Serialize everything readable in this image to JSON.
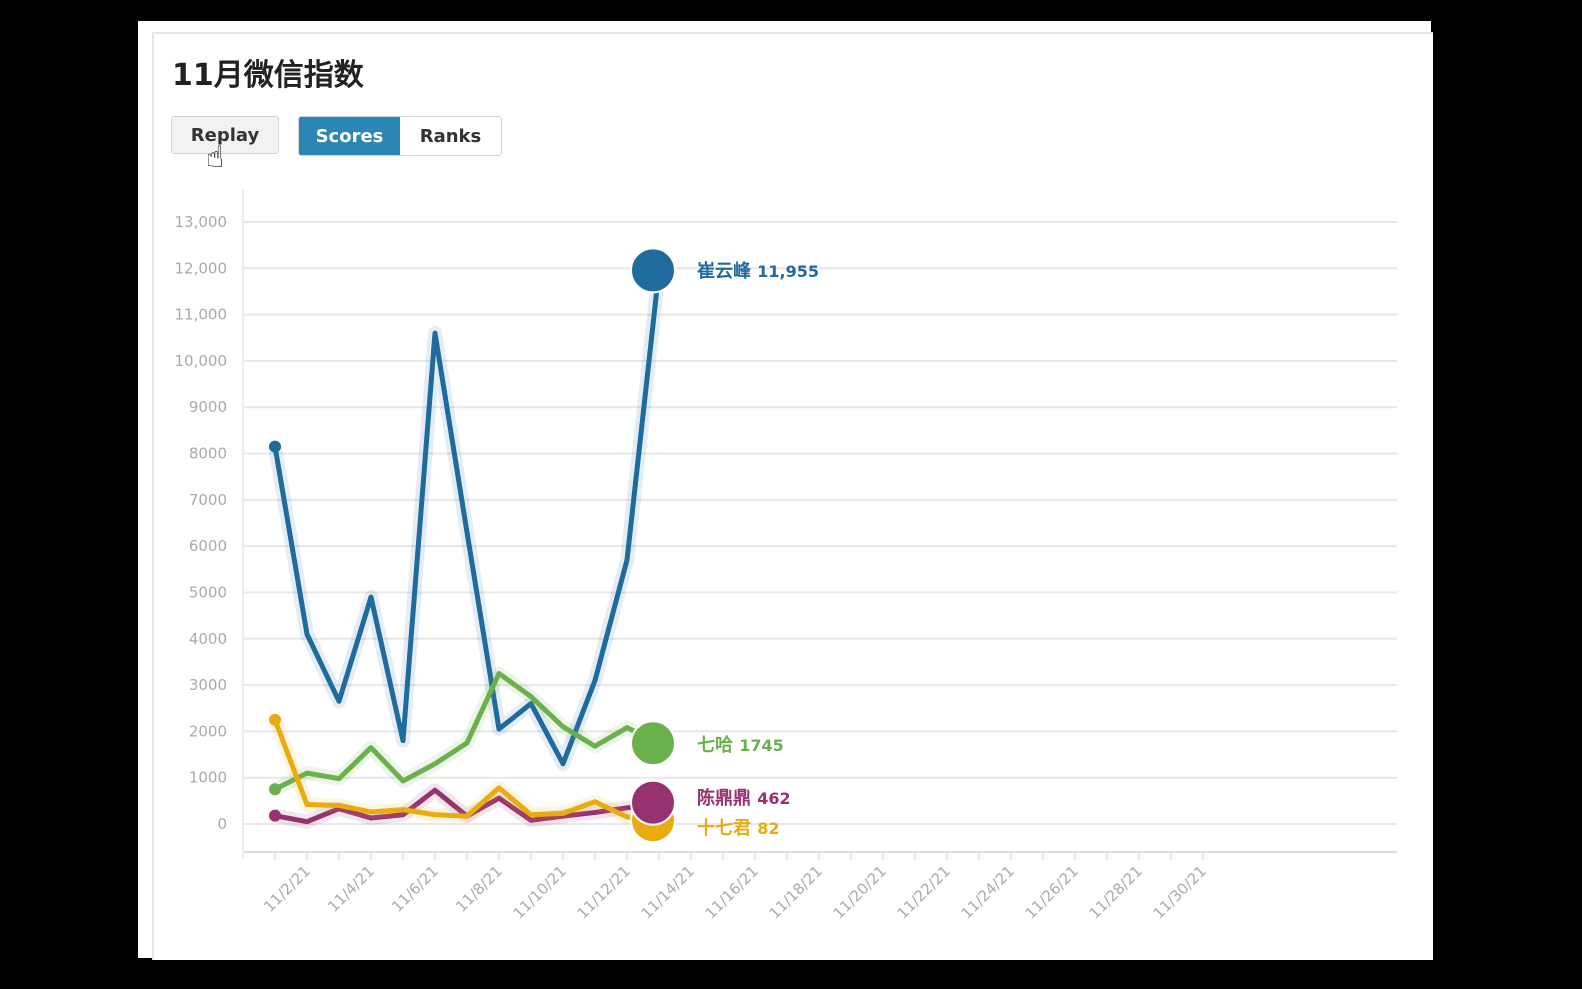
{
  "header": {
    "title": "11月微信指数"
  },
  "controls": {
    "replay_label": "Replay",
    "scores_label": "Scores",
    "ranks_label": "Ranks",
    "active": "Scores"
  },
  "chart_data": {
    "type": "line",
    "title": "11月微信指数",
    "xlabel": "",
    "ylabel": "",
    "x": [
      "11/1/21",
      "11/2/21",
      "11/3/21",
      "11/4/21",
      "11/5/21",
      "11/6/21",
      "11/7/21",
      "11/8/21",
      "11/9/21",
      "11/10/21",
      "11/11/21",
      "11/12/21",
      "11/13/21"
    ],
    "x_tick_labels": [
      "11/2/21",
      "11/4/21",
      "11/6/21",
      "11/8/21",
      "11/10/21",
      "11/12/21",
      "11/14/21",
      "11/16/21",
      "11/18/21",
      "11/20/21",
      "11/22/21",
      "11/24/21",
      "11/26/21",
      "11/28/21",
      "11/30/21"
    ],
    "xlim": [
      "11/1/21",
      "11/30/21"
    ],
    "ylim": [
      0,
      13000
    ],
    "y_tick_labels": [
      "0",
      "1000",
      "2000",
      "3000",
      "4000",
      "5000",
      "6000",
      "7000",
      "8000",
      "9000",
      "10,000",
      "11,000",
      "12,000",
      "13,000"
    ],
    "grid": true,
    "series": [
      {
        "name": "崔云峰",
        "color": "#1f6b9e",
        "end_label": "11,955",
        "values": [
          8150,
          4100,
          2650,
          4900,
          1800,
          10600,
          6300,
          2050,
          2600,
          1300,
          3100,
          5700,
          11955
        ]
      },
      {
        "name": "七哈",
        "color": "#6ab04c",
        "end_label": "1745",
        "values": [
          750,
          1100,
          980,
          1650,
          930,
          1300,
          1750,
          3250,
          2750,
          2100,
          1680,
          2080,
          1745
        ]
      },
      {
        "name": "陈鼎鼎",
        "color": "#963270",
        "end_label": "462",
        "values": [
          180,
          50,
          330,
          130,
          200,
          730,
          170,
          560,
          80,
          170,
          250,
          350,
          462
        ]
      },
      {
        "name": "十七君",
        "color": "#e8ab10",
        "end_label": "82",
        "values": [
          2250,
          420,
          400,
          260,
          310,
          200,
          170,
          780,
          200,
          230,
          480,
          150,
          82
        ]
      }
    ]
  }
}
